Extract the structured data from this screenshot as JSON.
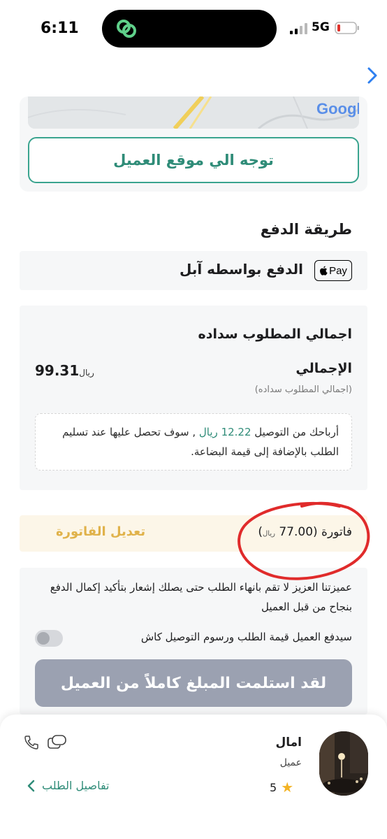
{
  "status_bar": {
    "time": "6:11",
    "network": "5G",
    "battery_color": "#e0322b"
  },
  "map": {
    "provider_logo": "Google"
  },
  "navigate_button": {
    "label": "توجه الي موقع العميل"
  },
  "payment": {
    "section_title": "طريقة الدفع",
    "method_label": "الدفع بواسطه آبل",
    "badge_text": "Pay"
  },
  "totals": {
    "title": "اجمالي المطلوب سداده",
    "total_label": "الإجمالي",
    "total_sub": "(اجمالي المطلوب سداده)",
    "amount": "99.31",
    "currency": "ريال",
    "earnings_prefix": "أرباحك من التوصيل",
    "earnings_amount": "12.22 ريال",
    "earnings_suffix": ", سوف تحصل عليها عند تسليم الطلب بالإضافة إلى قيمة البضاعة."
  },
  "invoice": {
    "label_prefix": "فاتورة (",
    "amount": "77.00",
    "currency": "ريال",
    "label_suffix": ")",
    "edit_label": "تعديل الفاتورة"
  },
  "confirm": {
    "warning": "عميزتنا العزيز لا تقم بانهاء الطلب حتى يصلك إشعار بتأكيد إكمال الدفع بنجاح من قبل العميل",
    "cash_label": "سيدفع العميل قيمة الطلب ورسوم التوصيل كاش",
    "cash_toggle_on": false,
    "button_label": "لقد استلمت المبلغ كاملاً من العميل"
  },
  "customer": {
    "name": "امال",
    "role": "عميل",
    "rating": "5",
    "order_details_label": "تفاصيل الطلب"
  },
  "colors": {
    "accent_green": "#2f8c78",
    "invoice_gold": "#e0b24a",
    "disabled_button": "#9ba1b1",
    "annotation_red": "#e02b2b"
  }
}
